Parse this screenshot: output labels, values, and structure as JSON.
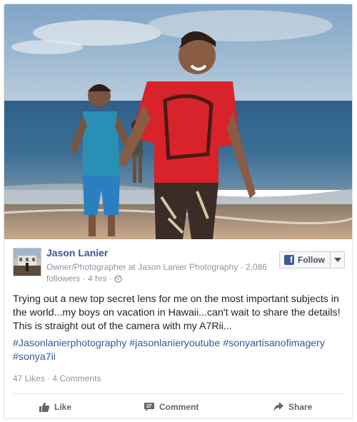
{
  "post": {
    "author": "Jason Lanier",
    "role": "Owner/Photographer",
    "at": "at",
    "company": "Jason Lanier Photography",
    "followers": "· 2,086 followers",
    "time": "· 4 hrs ·",
    "follow_label": "Follow",
    "text": "Trying out a new top secret lens for me on the most important subjects in the world...my boys on vacation in Hawaii...can't wait to share the details! This is straight out of the camera with my A7Rii...",
    "hashtags": [
      "#Jasonlanierphotography",
      "#jasonlanieryoutube",
      "#sonyartisanofimagery",
      "#sonya7ii"
    ],
    "likes": "47 Likes",
    "comments": "4 Comments"
  },
  "actions": {
    "like": "Like",
    "comment": "Comment",
    "share": "Share"
  },
  "colors": {
    "link_blue": "#365899",
    "facebook_blue": "#3b5998",
    "meta_gray": "#90949c",
    "action_gray": "#616770"
  },
  "icons": [
    "globe-icon",
    "facebook-icon",
    "chevron-down-icon",
    "thumbs-up-icon",
    "comment-icon",
    "share-icon"
  ]
}
